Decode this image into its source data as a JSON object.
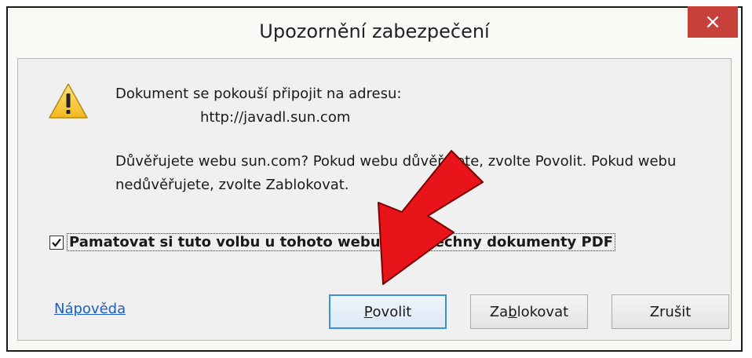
{
  "dialog": {
    "title": "Upozornění zabezpečení",
    "close_glyph": "×",
    "message_line1": "Dokument se pokouší připojit na adresu:",
    "url": "http://javadl.sun.com",
    "question": "Důvěřujete webu sun.com? Pokud webu důvěřujete, zvolte Povolit. Pokud webu nedůvěřujete, zvolte Zablokovat.",
    "remember_checked": true,
    "remember_label": "Pamatovat si tuto volbu u tohoto webu pro všechny dokumenty PDF",
    "help_link": "Nápověda",
    "buttons": {
      "allow_prefix": "",
      "allow_mnemonic": "P",
      "allow_rest": "ovolit",
      "block_prefix": "Za",
      "block_mnemonic": "b",
      "block_rest": "lokovat",
      "cancel": "Zrušit"
    }
  },
  "colors": {
    "close_button": "#c7403a",
    "default_button_border": "#3c8fd8",
    "link": "#1a5fcc",
    "arrow": "#e8141a"
  }
}
